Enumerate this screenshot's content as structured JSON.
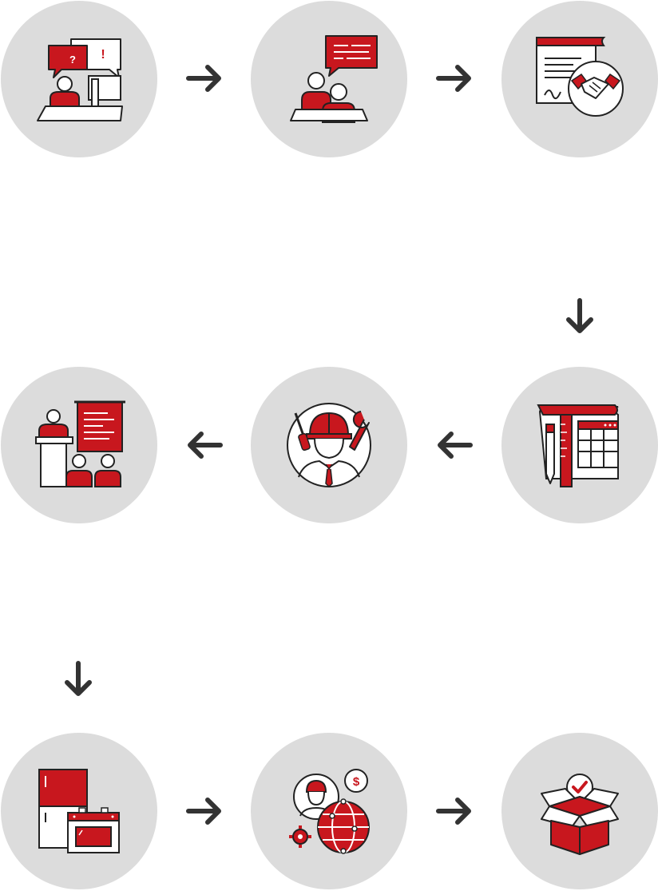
{
  "colors": {
    "accent": "#c8171e",
    "circle": "#dcdcdc",
    "line": "#222222",
    "arrow": "#333333"
  },
  "steps": [
    {
      "icon": "consultation-chat-icon"
    },
    {
      "icon": "meeting-discussion-icon"
    },
    {
      "icon": "contract-handshake-icon"
    },
    {
      "icon": "design-planning-icon"
    },
    {
      "icon": "engineer-tools-icon"
    },
    {
      "icon": "training-presentation-icon"
    },
    {
      "icon": "appliances-production-icon"
    },
    {
      "icon": "global-service-icon"
    },
    {
      "icon": "delivery-box-icon"
    }
  ],
  "arrows": [
    "right",
    "right",
    "down",
    "left",
    "left",
    "down",
    "right",
    "right"
  ]
}
